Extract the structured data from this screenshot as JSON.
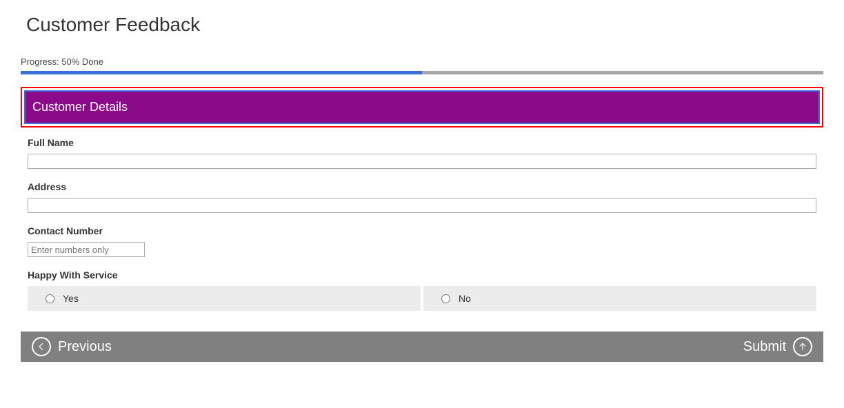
{
  "page_title": "Customer Feedback",
  "progress": {
    "label": "Progress: 50% Done",
    "percent": 50
  },
  "section": {
    "header": "Customer Details"
  },
  "fields": {
    "full_name": {
      "label": "Full Name",
      "value": ""
    },
    "address": {
      "label": "Address",
      "value": ""
    },
    "contact_number": {
      "label": "Contact Number",
      "value": "",
      "placeholder": "Enter numbers only"
    },
    "happy": {
      "label": "Happy With Service",
      "options": {
        "yes": "Yes",
        "no": "No"
      }
    }
  },
  "nav": {
    "previous": "Previous",
    "submit": "Submit"
  },
  "colors": {
    "section_bg": "#8a0a8a",
    "progress_fill": "#3b6fd8",
    "highlight": "#ff0000",
    "nav_bg": "#808080"
  }
}
